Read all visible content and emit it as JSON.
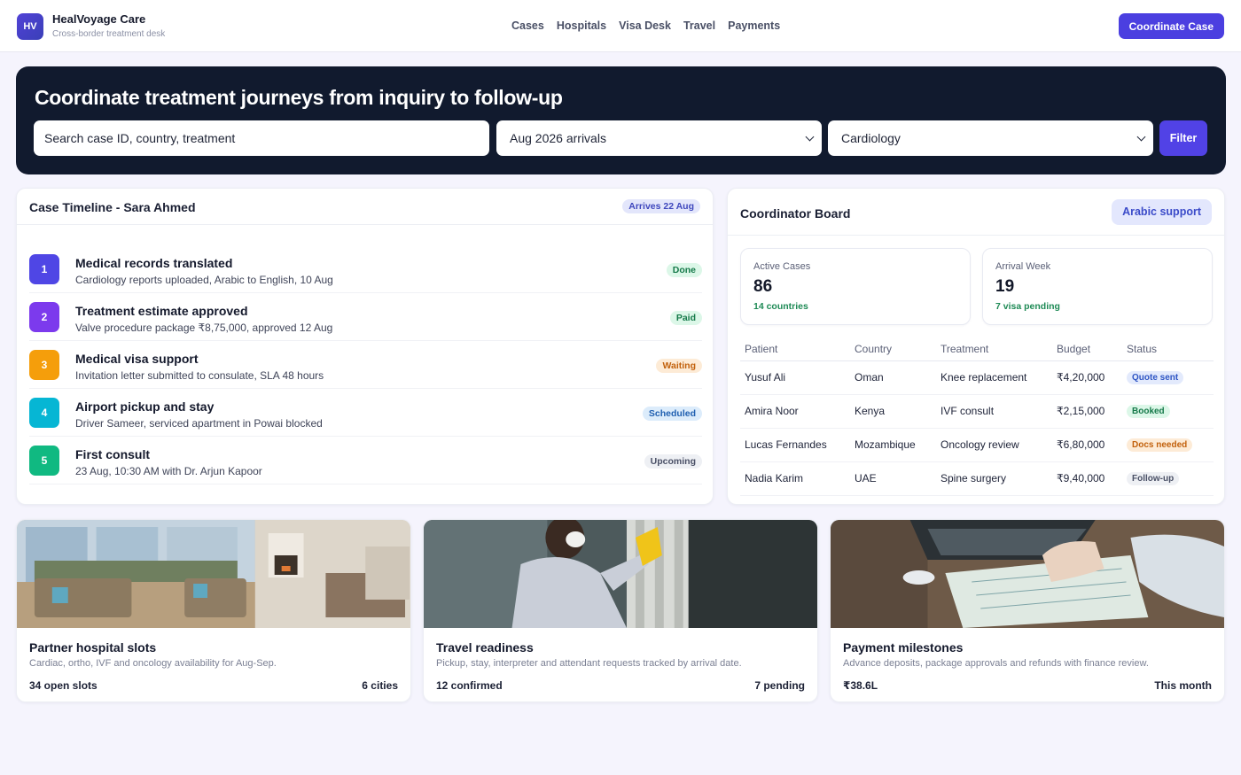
{
  "brand": {
    "logo": "HV",
    "name": "HealVoyage Care",
    "tagline": "Cross-border treatment desk"
  },
  "nav": [
    "Cases",
    "Hospitals",
    "Visa Desk",
    "Travel",
    "Payments"
  ],
  "header_cta": "Coordinate Case",
  "hero": {
    "title": "Coordinate treatment journeys from inquiry to follow-up",
    "search_placeholder": "Search case ID, country, treatment",
    "arrival_filter": "Aug 2026 arrivals",
    "specialty_filter": "Cardiology",
    "filter_label": "Filter"
  },
  "timeline": {
    "title": "Case Timeline - Sara Ahmed",
    "arrival": "Arrives 22 Aug",
    "items": [
      {
        "num": "1",
        "title": "Medical records translated",
        "desc": "Cardiology reports uploaded, Arabic to English, 10 Aug",
        "status": "Done",
        "color": "#4f46e5"
      },
      {
        "num": "2",
        "title": "Treatment estimate approved",
        "desc": "Valve procedure package ₹8,75,000, approved 12 Aug",
        "status": "Paid",
        "color": "#7c3aed"
      },
      {
        "num": "3",
        "title": "Medical visa support",
        "desc": "Invitation letter submitted to consulate, SLA 48 hours",
        "status": "Waiting",
        "color": "#f59e0b"
      },
      {
        "num": "4",
        "title": "Airport pickup and stay",
        "desc": "Driver Sameer, serviced apartment in Powai blocked",
        "status": "Scheduled",
        "color": "#06b6d4"
      },
      {
        "num": "5",
        "title": "First consult",
        "desc": "23 Aug, 10:30 AM with Dr. Arjun Kapoor",
        "status": "Upcoming",
        "color": "#10b981"
      }
    ]
  },
  "board": {
    "title": "Coordinator Board",
    "language": "Arabic support",
    "stats": [
      {
        "label": "Active Cases",
        "value": "86",
        "sub": "14 countries"
      },
      {
        "label": "Arrival Week",
        "value": "19",
        "sub": "7 visa pending"
      }
    ],
    "columns": [
      "Patient",
      "Country",
      "Treatment",
      "Budget",
      "Status"
    ],
    "rows": [
      {
        "patient": "Yusuf Ali",
        "country": "Oman",
        "treatment": "Knee replacement",
        "budget": "₹4,20,000",
        "status": "Quote sent"
      },
      {
        "patient": "Amira Noor",
        "country": "Kenya",
        "treatment": "IVF consult",
        "budget": "₹2,15,000",
        "status": "Booked"
      },
      {
        "patient": "Lucas Fernandes",
        "country": "Mozambique",
        "treatment": "Oncology review",
        "budget": "₹6,80,000",
        "status": "Docs needed"
      },
      {
        "patient": "Nadia Karim",
        "country": "UAE",
        "treatment": "Spine surgery",
        "budget": "₹9,40,000",
        "status": "Follow-up"
      }
    ]
  },
  "cards": [
    {
      "title": "Partner hospital slots",
      "desc": "Cardiac, ortho, IVF and oncology availability for Aug-Sep.",
      "left": "34 open slots",
      "right": "6 cities"
    },
    {
      "title": "Travel readiness",
      "desc": "Pickup, stay, interpreter and attendant requests tracked by arrival date.",
      "left": "12 confirmed",
      "right": "7 pending"
    },
    {
      "title": "Payment milestones",
      "desc": "Advance deposits, package approvals and refunds with finance review.",
      "left": "₹38.6L",
      "right": "This month"
    }
  ],
  "colors": {
    "accent": "#4b3fe0",
    "hero_bg": "#111a2e",
    "page_bg": "#f5f4fd"
  }
}
